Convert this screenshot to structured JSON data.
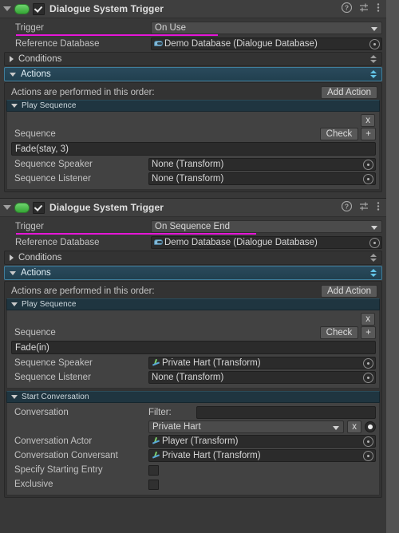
{
  "components": [
    {
      "title": "Dialogue System Trigger",
      "enabled": true,
      "icons": {
        "help": "help-icon",
        "preset": "preset-icon",
        "menu": "kebab-menu-icon"
      },
      "trigger": {
        "label": "Trigger",
        "value": "On Use"
      },
      "reference_database": {
        "label": "Reference Database",
        "value": "Demo Database (Dialogue Database)"
      },
      "conditions": {
        "label": "Conditions",
        "expanded": false
      },
      "actions": {
        "label": "Actions",
        "expanded": true,
        "caption": "Actions are performed in this order:",
        "add_button": "Add Action",
        "entries": [
          {
            "header": "Play Sequence",
            "remove_button": "x",
            "sequence_label": "Sequence",
            "check_button": "Check",
            "plus_button": "+",
            "sequence_value": "Fade(stay, 3)",
            "speaker_label": "Sequence Speaker",
            "speaker_value": "None (Transform)",
            "speaker_icon": "none",
            "listener_label": "Sequence Listener",
            "listener_value": "None (Transform)",
            "listener_icon": "none"
          }
        ]
      }
    },
    {
      "title": "Dialogue System Trigger",
      "enabled": true,
      "icons": {
        "help": "help-icon",
        "preset": "preset-icon",
        "menu": "kebab-menu-icon"
      },
      "trigger": {
        "label": "Trigger",
        "value": "On Sequence End"
      },
      "reference_database": {
        "label": "Reference Database",
        "value": "Demo Database (Dialogue Database)"
      },
      "conditions": {
        "label": "Conditions",
        "expanded": false
      },
      "actions": {
        "label": "Actions",
        "expanded": true,
        "caption": "Actions are performed in this order:",
        "add_button": "Add Action",
        "entries": [
          {
            "header": "Play Sequence",
            "remove_button": "x",
            "sequence_label": "Sequence",
            "check_button": "Check",
            "plus_button": "+",
            "sequence_value": "Fade(in)",
            "speaker_label": "Sequence Speaker",
            "speaker_value": "Private Hart (Transform)",
            "speaker_icon": "transform",
            "listener_label": "Sequence Listener",
            "listener_value": "None (Transform)",
            "listener_icon": "none"
          }
        ],
        "start_conversation": {
          "header": "Start Conversation",
          "conversation_label": "Conversation",
          "filter_label": "Filter:",
          "filter_value": "",
          "conversation_value": "Private Hart",
          "clear_button": "x",
          "actor_label": "Conversation Actor",
          "actor_value": "Player (Transform)",
          "conversant_label": "Conversation Conversant",
          "conversant_value": "Private Hart (Transform)",
          "specify_entry_label": "Specify Starting Entry",
          "specify_entry_checked": false,
          "exclusive_label": "Exclusive",
          "exclusive_checked": false
        }
      }
    }
  ],
  "colors": {
    "accent_magenta": "#e616d8",
    "panel_bg": "#383838",
    "header_bg": "#3f3f3f",
    "active_foldout": "#2a4a5c",
    "enabled_capsule": "#35a635"
  }
}
